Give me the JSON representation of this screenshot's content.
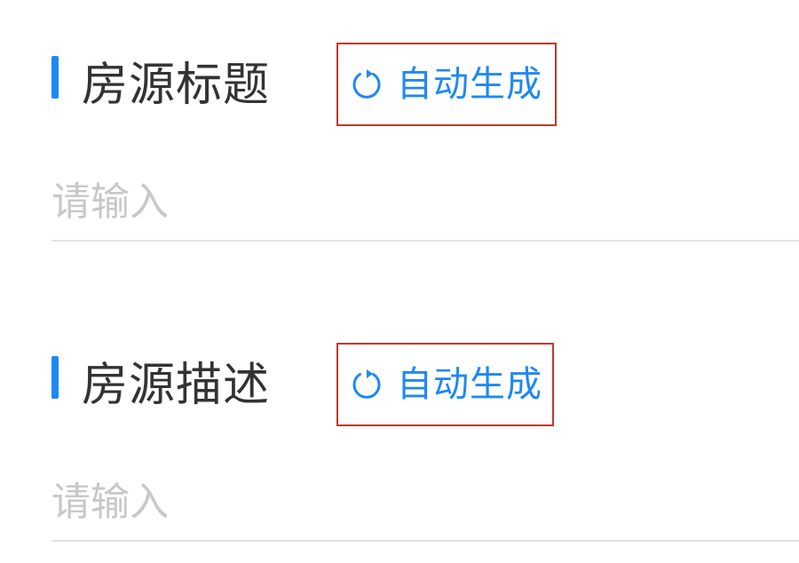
{
  "title_section": {
    "label": "房源标题",
    "generate_label": "自动生成",
    "input_placeholder": "请输入",
    "input_value": ""
  },
  "description_section": {
    "label": "房源描述",
    "generate_label": "自动生成",
    "input_placeholder": "请输入",
    "input_value": ""
  },
  "icons": {
    "generate": "refresh-icon"
  },
  "colors": {
    "accent": "#1e88f5",
    "label_text": "#333333",
    "placeholder": "#c8c8c8",
    "divider": "#e2e2e2",
    "highlight_box": "#c0392b"
  }
}
